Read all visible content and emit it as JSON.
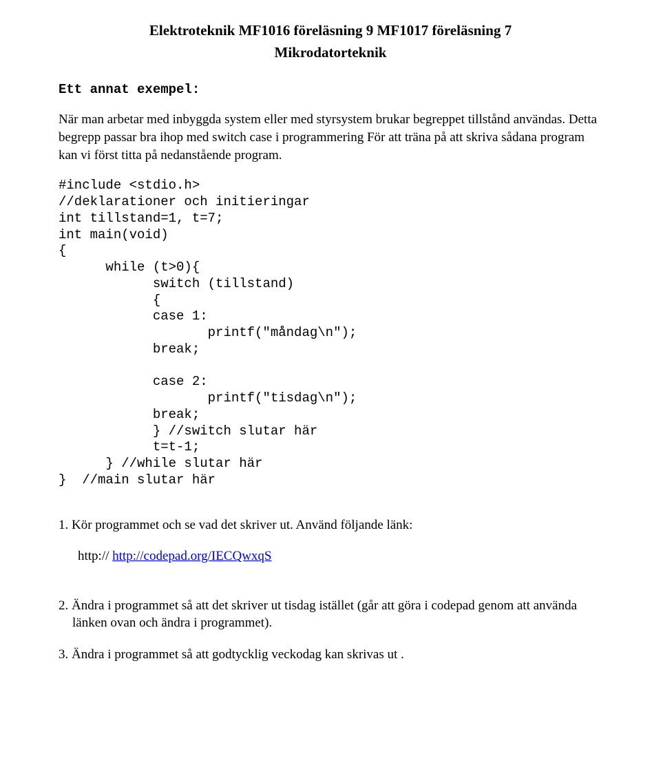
{
  "title": "Elektroteknik MF1016 föreläsning 9  MF1017 föreläsning 7",
  "subtitle": "Mikrodatorteknik",
  "example_label": "Ett annat exempel:",
  "intro_para": "När man arbetar med inbyggda system eller med styrsystem brukar begreppet tillstånd användas. Detta begrepp passar bra ihop med switch case i programmering  För att träna på att skriva sådana program kan vi först titta på nedanstående program.",
  "code": "#include <stdio.h>\n//deklarationer och initieringar\nint tillstand=1, t=7;\nint main(void)\n{\n      while (t>0){\n            switch (tillstand)\n            {\n            case 1:\n                   printf(\"måndag\\n\");\n            break;\n\n            case 2:\n                   printf(\"tisdag\\n\");\n            break;\n            } //switch slutar här\n            t=t-1;\n      } //while slutar här\n}  //main slutar här",
  "item1_text": "1. Kör programmet och se vad det skriver ut. Använd följande länk:",
  "item1_url_prefix": "http:// ",
  "item1_url": "http://codepad.org/IECQwxqS",
  "item2_text": "2. Ändra i programmet så att det skriver ut tisdag istället (går att göra i codepad genom att använda länken ovan och ändra i programmet).",
  "item3_text": "3. Ändra i programmet så att godtycklig veckodag kan skrivas ut ."
}
